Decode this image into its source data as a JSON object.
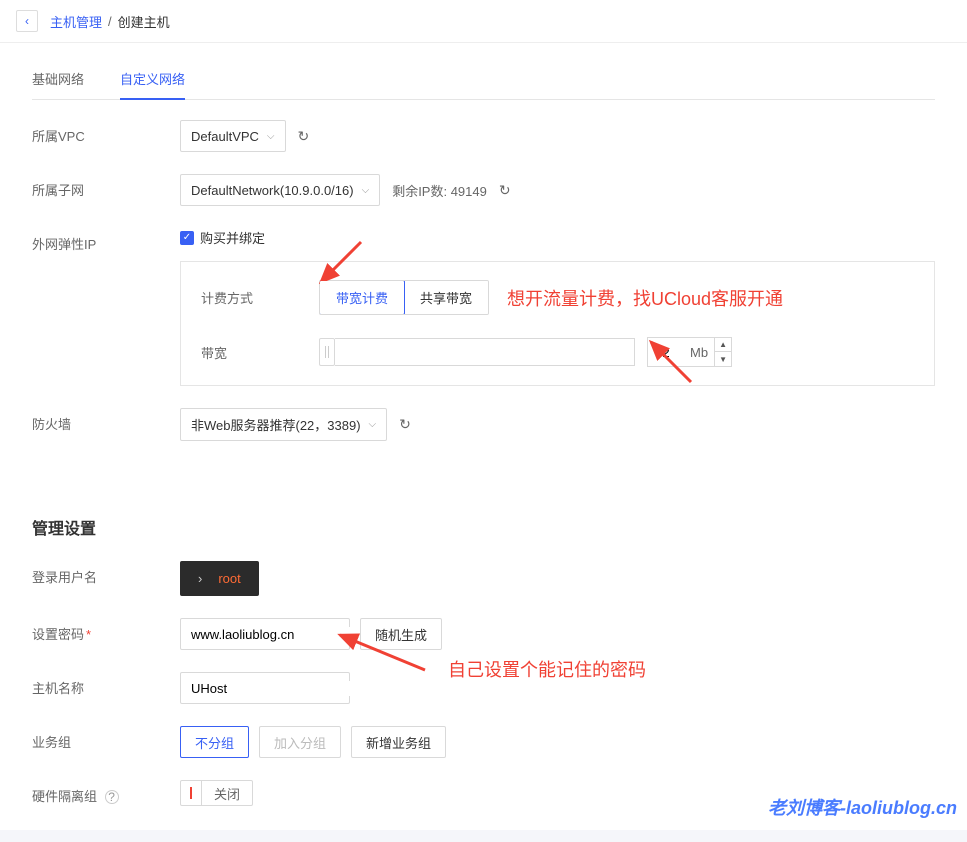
{
  "breadcrumb": {
    "back": "‹",
    "parent": "主机管理",
    "current": "创建主机"
  },
  "tabs": {
    "basic": "基础网络",
    "custom": "自定义网络"
  },
  "vpc": {
    "label": "所属VPC",
    "value": "DefaultVPC"
  },
  "subnet": {
    "label": "所属子网",
    "value": "DefaultNetwork(10.9.0.0/16)",
    "remaining": "剩余IP数: 49149"
  },
  "eip": {
    "label": "外网弹性IP",
    "checkbox": "购买并绑定"
  },
  "billing": {
    "label": "计费方式",
    "bandwidth": "带宽计费",
    "shared": "共享带宽",
    "annotation": "想开流量计费，找UCloud客服开通"
  },
  "bandwidth": {
    "label": "带宽",
    "value": "2",
    "unit": "Mb"
  },
  "firewall": {
    "label": "防火墙",
    "value": "非Web服务器推荐(22，3389)"
  },
  "management": {
    "title": "管理设置"
  },
  "login": {
    "label": "登录用户名",
    "user": "root"
  },
  "password": {
    "label": "设置密码",
    "value": "www.laoliublog.cn",
    "random": "随机生成",
    "annotation": "自己设置个能记住的密码"
  },
  "hostname": {
    "label": "主机名称",
    "value": "UHost"
  },
  "bizgroup": {
    "label": "业务组",
    "none": "不分组",
    "join": "加入分组",
    "add": "新增业务组"
  },
  "isolation": {
    "label": "硬件隔离组",
    "toggle": "关闭"
  },
  "watermark": "老刘博客-laoliublog.cn"
}
